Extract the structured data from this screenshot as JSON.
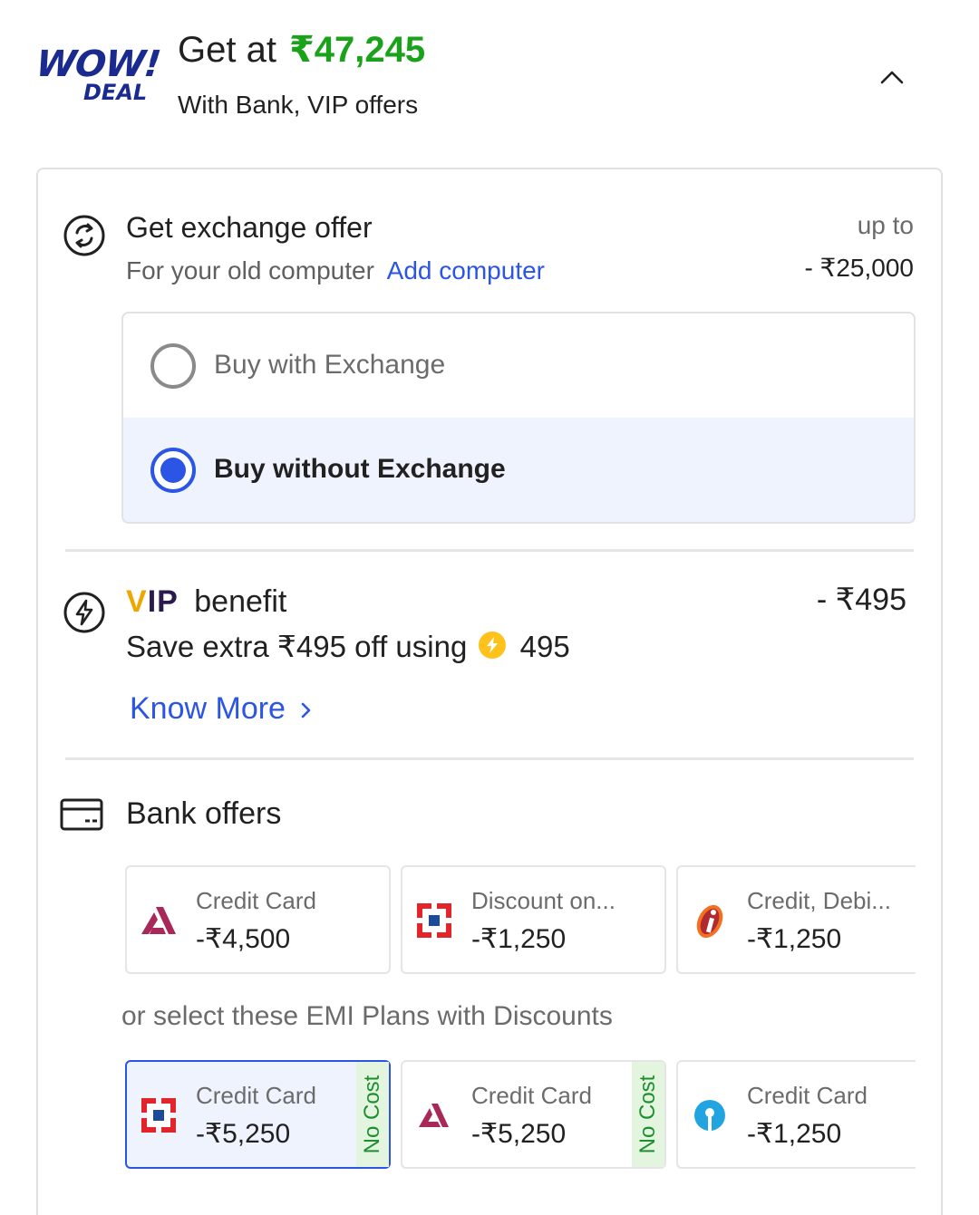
{
  "header": {
    "logo_wow": "WOW!",
    "logo_deal": "DEAL",
    "title_prefix": "Get at",
    "price": "₹47,245",
    "subtitle": "With Bank, VIP offers"
  },
  "exchange": {
    "title": "Get exchange offer",
    "subtitle": "For your old computer",
    "add_link": "Add computer",
    "upto_label": "up to",
    "amount": "- ₹25,000",
    "options": [
      {
        "label": "Buy with Exchange",
        "selected": false
      },
      {
        "label": "Buy without Exchange",
        "selected": true
      }
    ]
  },
  "vip": {
    "logo_v": "V",
    "logo_rest": "IP",
    "title": "benefit",
    "amount": "- ₹495",
    "subtitle": "Save extra ₹495 off using",
    "coins": "495",
    "know_more": "Know More"
  },
  "bank": {
    "title": "Bank offers",
    "offers": [
      {
        "label": "Credit Card",
        "value": "-₹4,500",
        "logo": "axis-bank-logo"
      },
      {
        "label": "Discount on...",
        "value": "-₹1,250",
        "logo": "hdfc-bank-logo"
      },
      {
        "label": "Credit, Debi...",
        "value": "-₹1,250",
        "logo": "icici-bank-logo"
      }
    ],
    "emi_text": "or select these EMI Plans with Discounts",
    "emi_plans": [
      {
        "label": "Credit Card",
        "value": "-₹5,250",
        "badge": "No Cost",
        "logo": "hdfc-bank-logo",
        "selected": true
      },
      {
        "label": "Credit Card",
        "value": "-₹5,250",
        "badge": "No Cost",
        "logo": "axis-bank-logo",
        "selected": false
      },
      {
        "label": "Credit Card",
        "value": "-₹1,250",
        "badge": "",
        "logo": "sbi-bank-logo",
        "selected": false
      }
    ]
  },
  "colors": {
    "price_green": "#1aa31a",
    "link_blue": "#2a55e5",
    "selected_bg": "#eef3fe",
    "no_cost_bg": "#e3f4df"
  }
}
